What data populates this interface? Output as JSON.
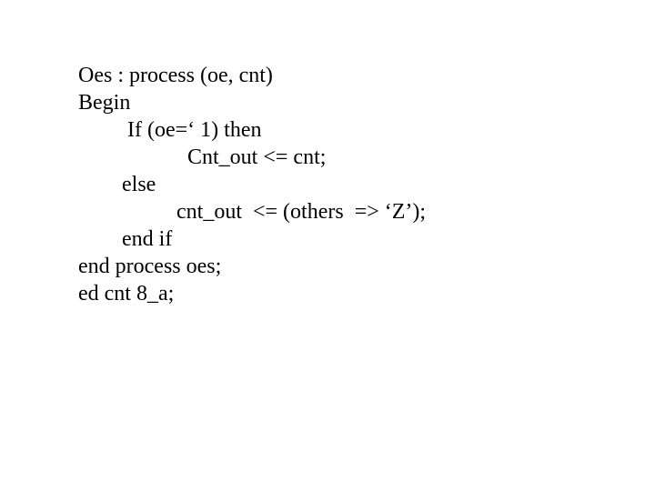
{
  "code": {
    "line1": "Oes : process (oe, cnt)",
    "line2": "Begin",
    "line3": "         If (oe=‘ 1) then",
    "line4": "                    Cnt_out <= cnt;",
    "line5": "        else",
    "line6": "                  cnt_out  <= (others  => ‘Z’);",
    "line7": "        end if",
    "line8": "end process oes;",
    "line9": "ed cnt 8_a;"
  }
}
